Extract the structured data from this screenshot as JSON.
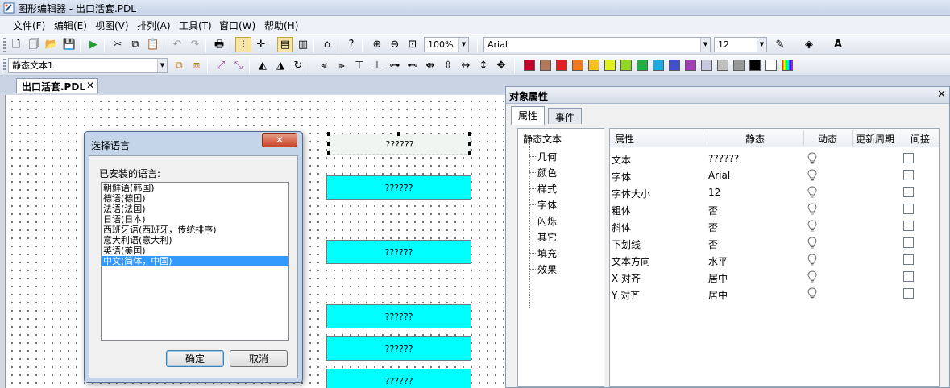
{
  "window": {
    "title": "图形编辑器 - 出口活套.PDL"
  },
  "menu": [
    "文件(F)",
    "编辑(E)",
    "视图(V)",
    "排列(A)",
    "工具(T)",
    "窗口(W)",
    "帮助(H)"
  ],
  "toolbar1": {
    "zoom": "100%",
    "font": "Arial",
    "font_size": "12"
  },
  "toolbar2": {
    "object_select": "静态文本1",
    "palette": [
      "#c0002a",
      "#b07a5a",
      "#e02020",
      "#f07820",
      "#f8c020",
      "#e0f020",
      "#90d820",
      "#20b040",
      "#20a8e0",
      "#4050c8",
      "#a040b0",
      "#c8c8e0",
      "#c0c0c0",
      "#989898",
      "#000000",
      "#ffffff"
    ]
  },
  "doc_tab": {
    "label": "出口活套.PDL"
  },
  "canvas": {
    "objects": [
      "??????",
      "??????",
      "??????",
      "??????",
      "??????",
      "??????"
    ]
  },
  "dialog": {
    "title": "选择语言",
    "label": "已安装的语言:",
    "languages": [
      "朝鲜语(韩国)",
      "德语(德国)",
      "法语(法国)",
      "日语(日本)",
      "西班牙语(西班牙，传统排序)",
      "意大利语(意大利)",
      "英语(美国)",
      "中文(简体，中国)"
    ],
    "selected_index": 7,
    "ok": "确定",
    "cancel": "取消"
  },
  "panel": {
    "title": "对象属性",
    "tabs": [
      "属性",
      "事件"
    ],
    "tree_root": "静态文本",
    "tree_items": [
      "几何",
      "颜色",
      "样式",
      "字体",
      "闪烁",
      "其它",
      "填充",
      "效果"
    ],
    "columns": [
      "属性",
      "静态",
      "动态",
      "更新周期",
      "间接"
    ],
    "rows": [
      {
        "name": "文本",
        "value": "??????"
      },
      {
        "name": "字体",
        "value": "Arial"
      },
      {
        "name": "字体大小",
        "value": "12"
      },
      {
        "name": "粗体",
        "value": "否"
      },
      {
        "name": "斜体",
        "value": "否"
      },
      {
        "name": "下划线",
        "value": "否"
      },
      {
        "name": "文本方向",
        "value": "水平"
      },
      {
        "name": "X 对齐",
        "value": "居中"
      },
      {
        "name": "Y 对齐",
        "value": "居中"
      }
    ]
  }
}
